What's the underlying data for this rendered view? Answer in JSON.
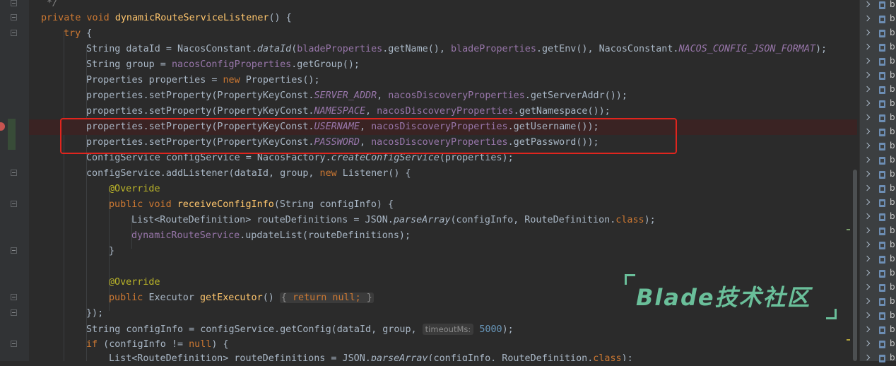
{
  "code": {
    "l0": "*/",
    "l1_a": "private void ",
    "l1_b": "dynamicRouteServiceListener",
    "l1_c": "() {",
    "l2_a": "try",
    "l2_b": " {",
    "l3_a": "String dataId = NacosConstant.",
    "l3_b": "dataId",
    "l3_c": "(",
    "l3_d": "bladeProperties",
    "l3_e": ".getName(), ",
    "l3_f": "bladeProperties",
    "l3_g": ".getEnv(), NacosConstant.",
    "l3_h": "NACOS_CONFIG_JSON_FORMAT",
    "l3_i": ");",
    "l4_a": "String group = ",
    "l4_b": "nacosConfigProperties",
    "l4_c": ".getGroup();",
    "l5_a": "Properties properties = ",
    "l5_b": "new",
    "l5_c": " Properties();",
    "l6_a": "properties.setProperty(PropertyKeyConst.",
    "l6_b": "SERVER_ADDR",
    "l6_c": ", ",
    "l6_d": "nacosDiscoveryProperties",
    "l6_e": ".getServerAddr());",
    "l7_a": "properties.setProperty(PropertyKeyConst.",
    "l7_b": "NAMESPACE",
    "l7_c": ", ",
    "l7_d": "nacosDiscoveryProperties",
    "l7_e": ".getNamespace());",
    "l8_a": "properties.setProperty(PropertyKeyConst.",
    "l8_b": "USERNAME",
    "l8_c": ", ",
    "l8_d": "nacosDiscoveryProperties",
    "l8_e": ".getUsername());",
    "l9_a": "properties.setProperty(PropertyKeyConst.",
    "l9_b": "PASSWORD",
    "l9_c": ", ",
    "l9_d": "nacosDiscoveryProperties",
    "l9_e": ".getPassword());",
    "l10_a": "ConfigService configService = NacosFactory.",
    "l10_b": "createConfigService",
    "l10_c": "(properties);",
    "l11_a": "configService.addListener(dataId, group, ",
    "l11_b": "new",
    "l11_c": " Listener() {",
    "l12": "@Override",
    "l13_a": "public void ",
    "l13_b": "receiveConfigInfo",
    "l13_c": "(String configInfo) {",
    "l14_a": "List<RouteDefinition> routeDefinitions = JSON.",
    "l14_b": "parseArray",
    "l14_c": "(configInfo, RouteDefinition.",
    "l14_d": "class",
    "l14_e": ");",
    "l15_a": "dynamicRouteService",
    "l15_b": ".updateList(routeDefinitions);",
    "l16": "}",
    "l18": "@Override",
    "l19_a": "public ",
    "l19_b": "Executor ",
    "l19_c": "getExecutor",
    "l19_d": "() ",
    "l19_e": "{ ",
    "l19_f": "return null;",
    "l19_g": " }",
    "l20": "});",
    "l21_a": "String configInfo = configService.getConfig(dataId, group, ",
    "l21_hint": "timeoutMs:",
    "l21_b": " 5000",
    "l21_c": ");",
    "l22_a": "if",
    "l22_b": " (configInfo != ",
    "l22_c": "null",
    "l22_d": ") {",
    "l23_a": "List<RouteDefinition> routeDefinitions = JSON.",
    "l23_b": "parseArray",
    "l23_c": "(configInfo, RouteDefinition.",
    "l23_d": "class",
    "l23_e": ");"
  },
  "project_panel": {
    "item_label": "b",
    "item_count": 26,
    "icon": "class-file-icon"
  },
  "watermark": {
    "text": "Blade技术社区"
  },
  "colors": {
    "keyword": "#cc7832",
    "method": "#ffc66d",
    "field": "#9876aa",
    "annotation": "#bbb529",
    "number": "#6897bb",
    "highlight_box": "#e0251e",
    "watermark": "#6abf9a"
  }
}
